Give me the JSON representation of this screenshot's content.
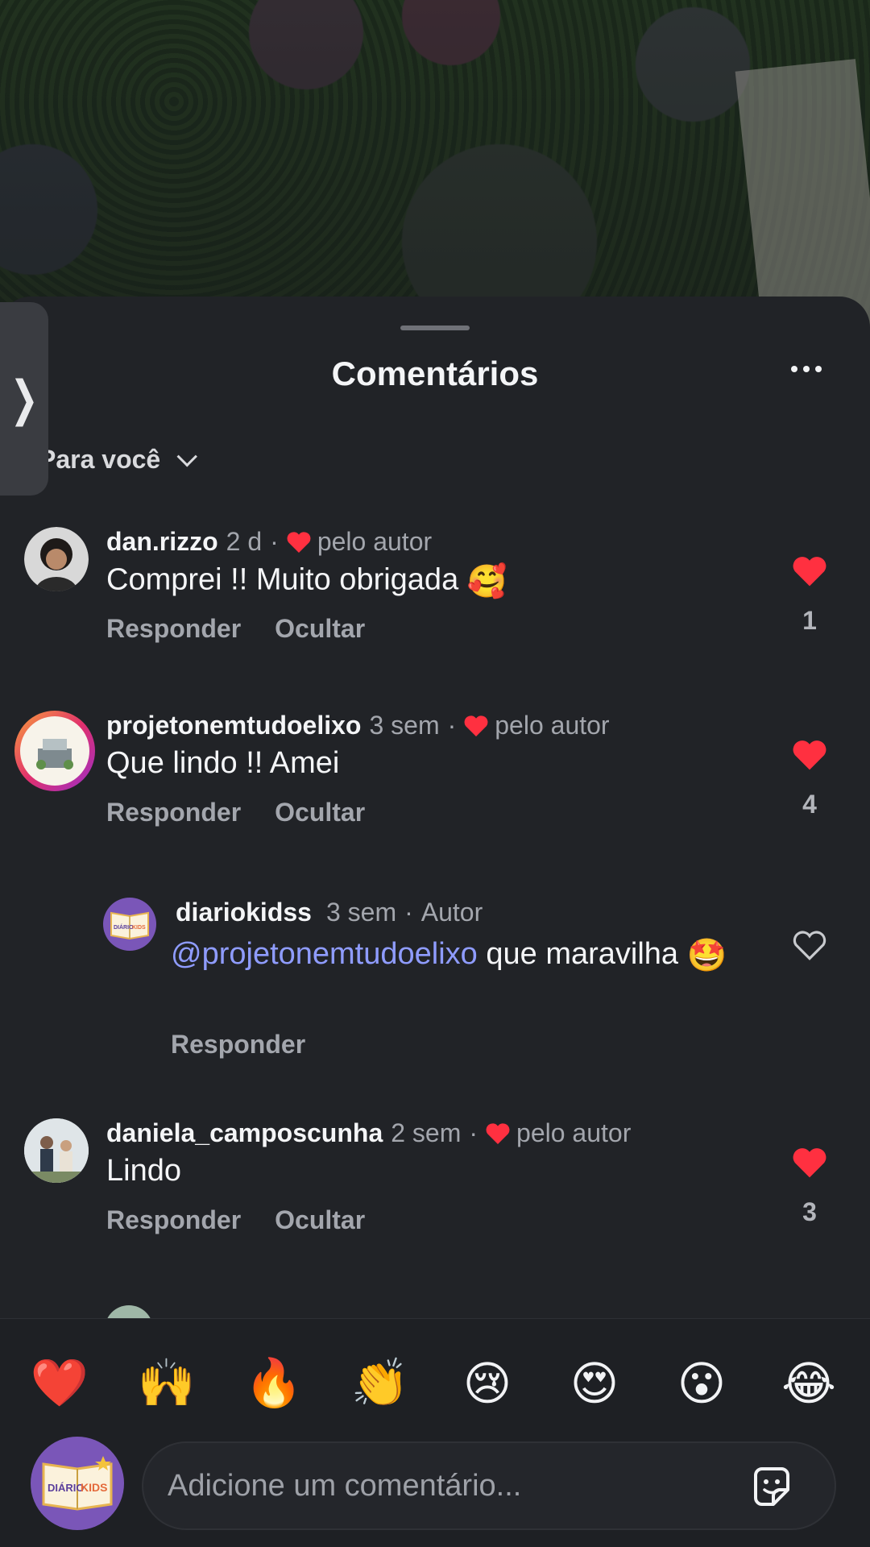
{
  "sheet": {
    "title": "Comentários",
    "sort_label": "Para você"
  },
  "comments": [
    {
      "username": "dan.rizzo",
      "time": "2 d",
      "liked_by_author": "pelo autor",
      "text": "Comprei !! Muito obrigada",
      "emoji": "🥰",
      "reply_label": "Responder",
      "hide_label": "Ocultar",
      "likes": "1"
    },
    {
      "username": "projetonemtudoelixo",
      "time": "3 sem",
      "liked_by_author": "pelo autor",
      "text": "Que lindo !! Amei",
      "reply_label": "Responder",
      "hide_label": "Ocultar",
      "likes": "4"
    },
    {
      "username": "diariokidss",
      "time": "3 sem",
      "author_tag": "Autor",
      "mention": "@projetonemtudoelixo",
      "text": "que maravilha",
      "emoji": "🤩",
      "reply_label": "Responder"
    },
    {
      "username": "daniela_camposcunha",
      "time": "2 sem",
      "liked_by_author": "pelo autor",
      "text": "Lindo",
      "reply_label": "Responder",
      "hide_label": "Ocultar",
      "likes": "3"
    }
  ],
  "reactions": [
    "❤️",
    "🙌",
    "🔥",
    "👏",
    "😢",
    "😍",
    "😮",
    "😂"
  ],
  "composer": {
    "placeholder": "Adicione um comentário..."
  },
  "brand": {
    "avatar_word_1": "DIÁRIO",
    "avatar_word_2": "KIDS",
    "accent": "#7a56b8"
  },
  "colors": {
    "like_red": "#ff3040",
    "mention_blue": "#8f9cff",
    "sheet_bg": "#212327"
  }
}
